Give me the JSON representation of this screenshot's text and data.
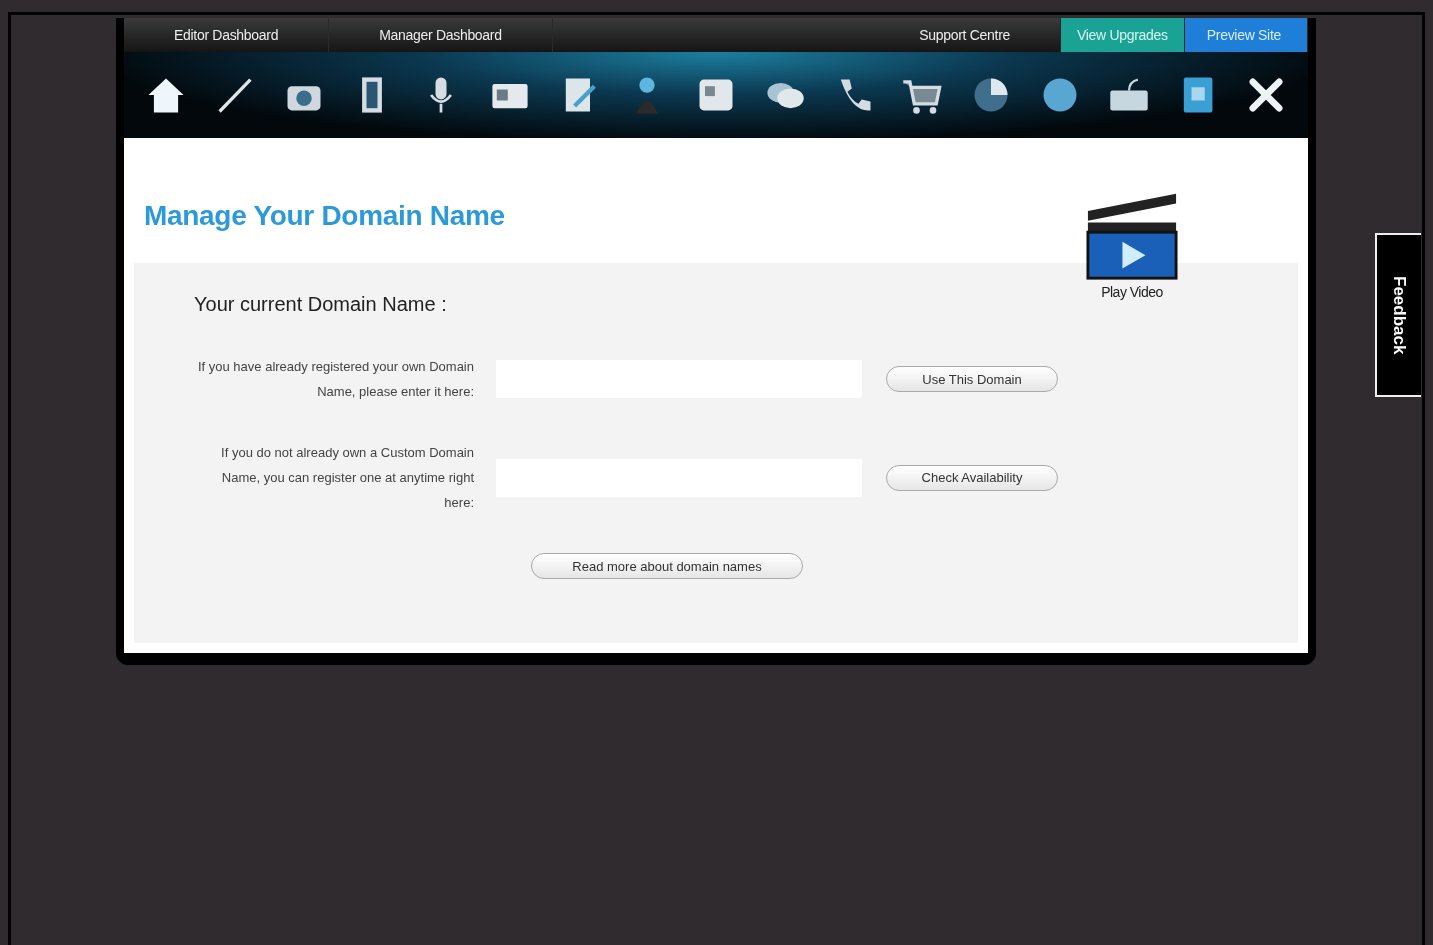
{
  "nav": [
    {
      "label": "Editor Dashboard",
      "kind": "plain"
    },
    {
      "label": "Manager Dashboard",
      "kind": "plain"
    },
    {
      "label": "Support Centre",
      "kind": "plain"
    },
    {
      "label": "View Upgrades",
      "kind": "upgrade"
    },
    {
      "label": "Preview Site",
      "kind": "preview"
    }
  ],
  "page": {
    "title": "Manage Your Domain Name",
    "video_label": "Play Video"
  },
  "form": {
    "current_label": "Your current Domain Name :",
    "rows": [
      {
        "label": "If you have already registered your own Domain Name, please enter it here:",
        "button": "Use This Domain"
      },
      {
        "label": "If you do not already own a Custom Domain Name, you can register one at anytime right here:",
        "button": "Check Availability"
      }
    ],
    "more_button": "Read more about domain names"
  },
  "feedback_tab": "Feedback"
}
